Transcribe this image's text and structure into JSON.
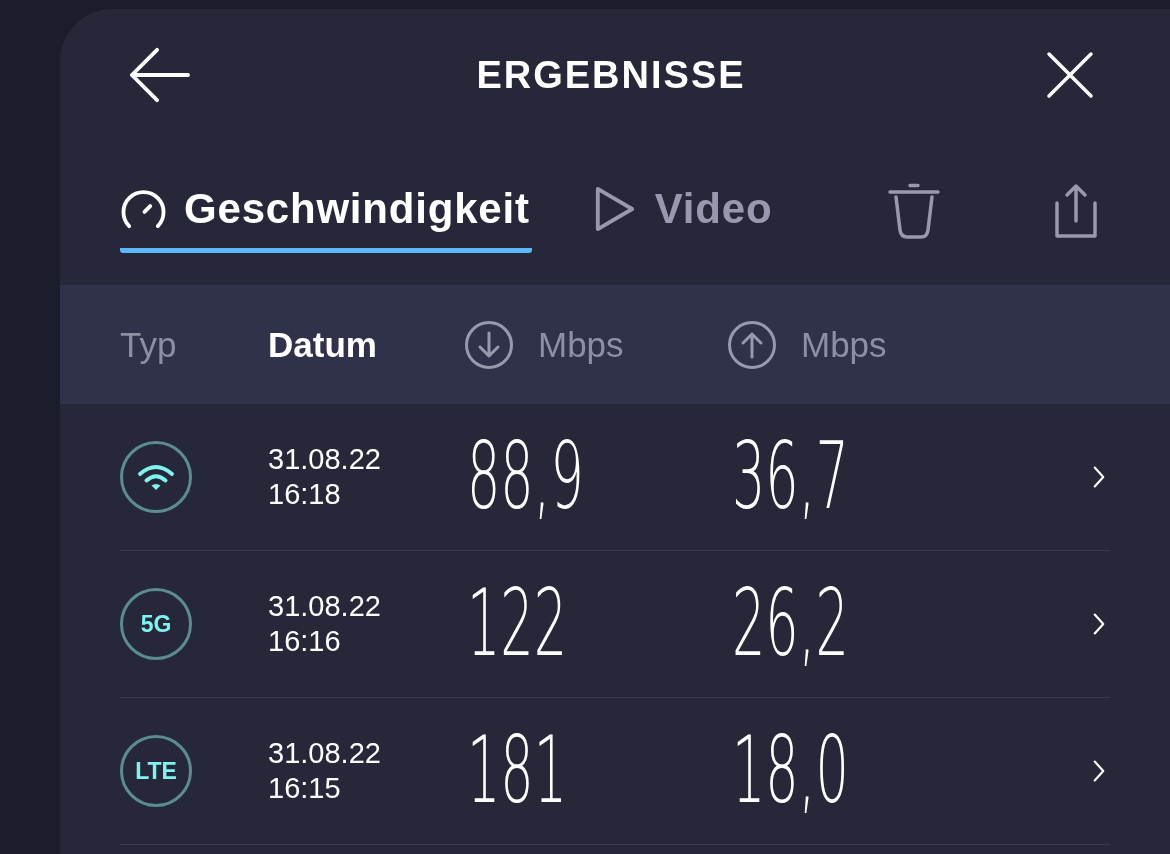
{
  "window": {
    "title": "ERGEBNISSE"
  },
  "tabs": [
    {
      "label": "Geschwindigkeit",
      "selected": true
    },
    {
      "label": "Video",
      "selected": false
    }
  ],
  "table": {
    "columns": [
      {
        "kind": "plain",
        "label": "Typ",
        "selected": false
      },
      {
        "kind": "plain",
        "label": "Datum",
        "selected": true
      },
      {
        "kind": "download",
        "label": "Mbps",
        "selected": false
      },
      {
        "kind": "upload",
        "label": "Mbps",
        "selected": false
      }
    ],
    "rows": [
      {
        "network": {
          "kind": "wifi"
        },
        "date": "31.08.22",
        "time": "16:18",
        "download": "88,9",
        "upload": "36,7"
      },
      {
        "network": {
          "kind": "label",
          "label": "5G"
        },
        "date": "31.08.22",
        "time": "16:16",
        "download": "122",
        "upload": "26,2"
      },
      {
        "network": {
          "kind": "label",
          "label": "LTE"
        },
        "date": "31.08.22",
        "time": "16:15",
        "download": "181",
        "upload": "18,0"
      }
    ]
  }
}
